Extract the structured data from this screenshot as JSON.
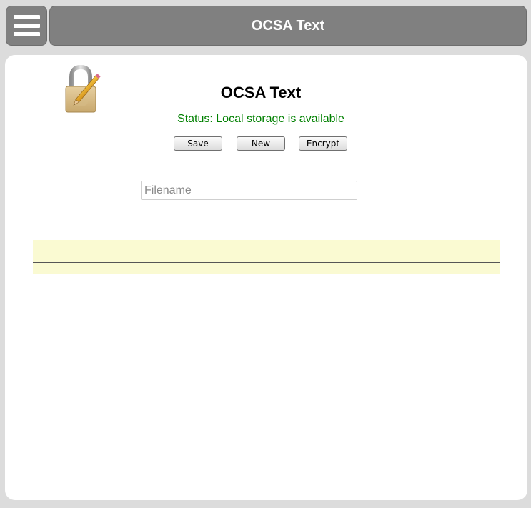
{
  "header": {
    "title": "OCSA Text"
  },
  "main": {
    "title": "OCSA Text",
    "status": "Status: Local storage is available",
    "buttons": {
      "save": "Save",
      "new": "New",
      "encrypt": "Encrypt"
    },
    "filename": {
      "placeholder": "Filename",
      "value": ""
    },
    "note": {
      "line_count": 3,
      "text": ""
    }
  },
  "icons": {
    "menu": "hamburger-menu-icon",
    "logo": "lock-pencil-icon"
  },
  "colors": {
    "header_bg": "#808080",
    "status_text": "#008000",
    "note_bg": "#fafad2"
  }
}
